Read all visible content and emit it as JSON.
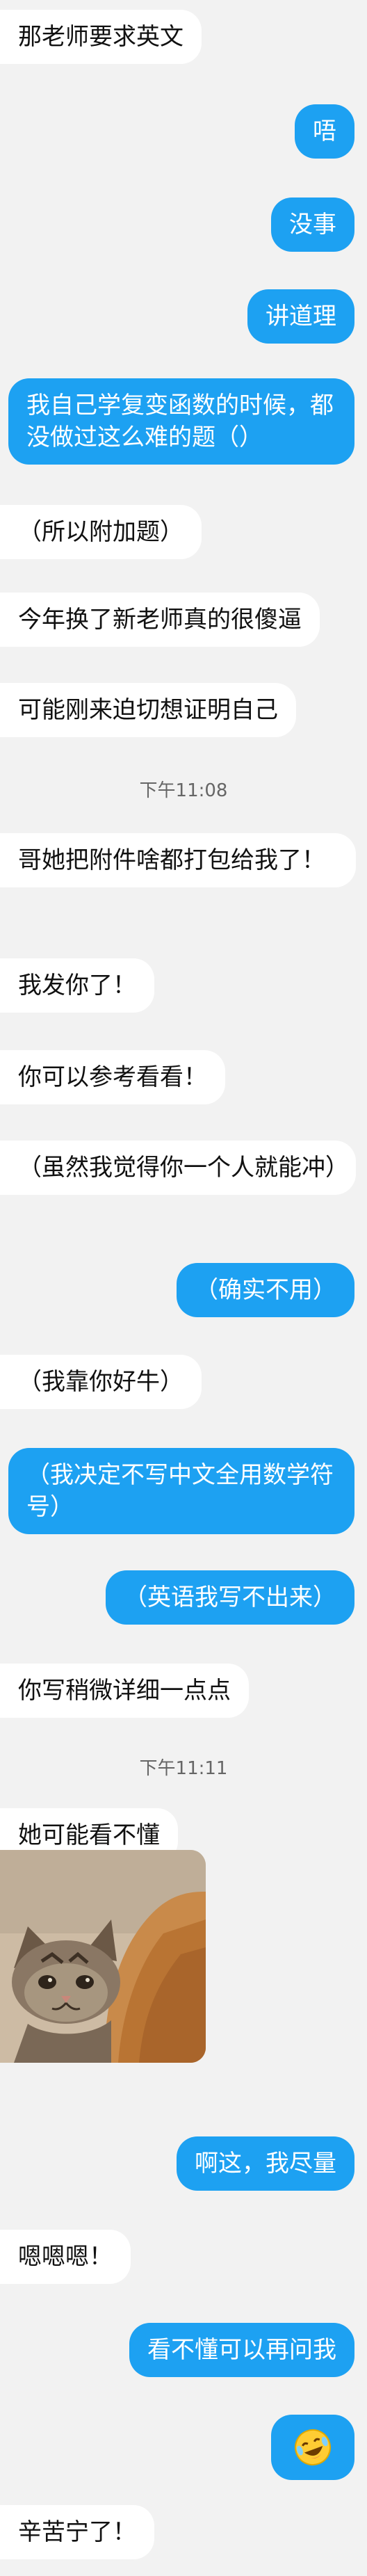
{
  "messages": [
    {
      "text": "那老师要求英文"
    },
    {
      "text": "唔"
    },
    {
      "text": "没事"
    },
    {
      "text": "讲道理"
    },
    {
      "text": "我自己学复变函数的时候，都没做过这么难的题（）"
    },
    {
      "text": "（所以附加题）"
    },
    {
      "text": "今年换了新老师真的很傻逼"
    },
    {
      "text": "可能刚来迫切想证明自己"
    },
    {
      "text": "哥她把附件啥都打包给我了！"
    },
    {
      "text": "我发你了！"
    },
    {
      "text": "你可以参考看看！"
    },
    {
      "text": "（虽然我觉得你一个人就能冲）"
    },
    {
      "text": "（确实不用）"
    },
    {
      "text": "（我靠你好牛）"
    },
    {
      "text": "（我决定不写中文全用数学符号）"
    },
    {
      "text": "（英语我写不出来）"
    },
    {
      "text": "你写稍微详细一点点"
    },
    {
      "text": "她可能看不懂"
    },
    {
      "text": "啊这，我尽量"
    },
    {
      "text": "嗯嗯嗯！"
    },
    {
      "text": "看不懂可以再问我"
    },
    {
      "text": "辛苦宁了！"
    }
  ],
  "timestamps": [
    "下午11:08",
    "下午11:11"
  ],
  "colors": {
    "background": "#f2f2f2",
    "incoming": "#ffffff",
    "outgoing": "#1da1f2"
  },
  "media": {
    "photo": "cat-photo",
    "emoji": "laughing-emoji-icon"
  }
}
